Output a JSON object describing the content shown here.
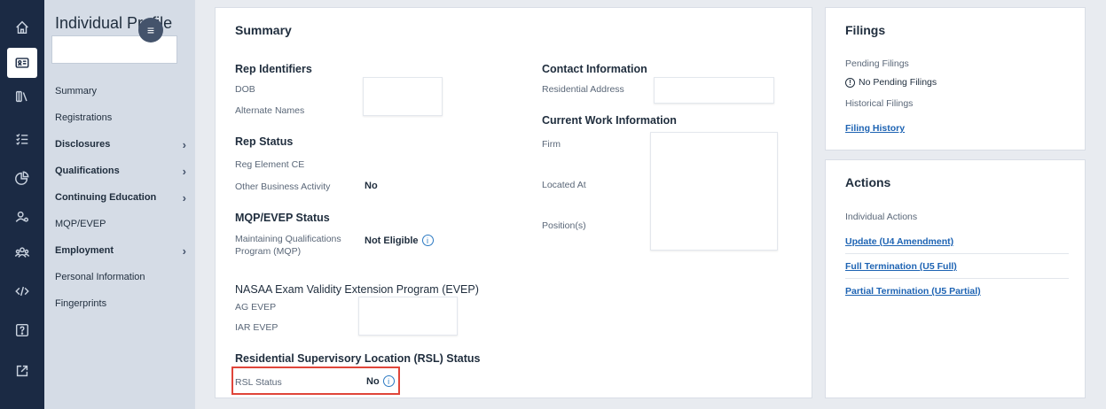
{
  "rail": {
    "icons": [
      "home-icon",
      "profile-card-icon",
      "library-icon",
      "checklist-icon",
      "pie-chart-icon",
      "user-settings-icon",
      "group-icon",
      "code-icon",
      "help-icon",
      "external-link-icon"
    ]
  },
  "nav": {
    "title": "Individual Profile",
    "items": [
      {
        "label": "Summary",
        "bold": false,
        "chevron": false
      },
      {
        "label": "Registrations",
        "bold": false,
        "chevron": false
      },
      {
        "label": "Disclosures",
        "bold": true,
        "chevron": true
      },
      {
        "label": "Qualifications",
        "bold": true,
        "chevron": true
      },
      {
        "label": "Continuing Education",
        "bold": true,
        "chevron": true
      },
      {
        "label": "MQP/EVEP",
        "bold": false,
        "chevron": false
      },
      {
        "label": "Employment",
        "bold": true,
        "chevron": true
      },
      {
        "label": "Personal Information",
        "bold": false,
        "chevron": false
      },
      {
        "label": "Fingerprints",
        "bold": false,
        "chevron": false
      }
    ]
  },
  "summary": {
    "title": "Summary",
    "rep_identifiers": {
      "heading": "Rep Identifiers",
      "dob": "DOB",
      "alternate_names": "Alternate Names"
    },
    "rep_status": {
      "heading": "Rep Status",
      "reg_element_ce": "Reg Element CE",
      "other_business_activity": "Other Business Activity",
      "other_business_value": "No"
    },
    "mqp_evep": {
      "heading": "MQP/EVEP Status",
      "mqp_label": "Maintaining Qualifications Program (MQP)",
      "mqp_value": "Not Eligible"
    },
    "nasaa": {
      "heading": "NASAA Exam Validity Extension Program (EVEP)",
      "ag_evep": "AG EVEP",
      "iar_evep": "IAR EVEP"
    },
    "rsl": {
      "heading": "Residential Supervisory Location (RSL) Status",
      "label": "RSL Status",
      "value": "No"
    },
    "contact": {
      "heading": "Contact Information",
      "residential_address": "Residential Address"
    },
    "work": {
      "heading": "Current Work Information",
      "firm": "Firm",
      "located_at": "Located At",
      "positions": "Position(s)"
    },
    "info_glyph": "i"
  },
  "filings": {
    "title": "Filings",
    "pending_label": "Pending Filings",
    "no_pending": "No Pending Filings",
    "historical_label": "Historical Filings",
    "history_link": "Filing History"
  },
  "actions": {
    "title": "Actions",
    "individual_label": "Individual Actions",
    "links": [
      "Update (U4 Amendment)",
      "Full Termination (U5 Full)",
      "Partial Termination (U5 Partial)"
    ]
  },
  "colors": {
    "rail": "#1b2a44",
    "nav": "#d5dce6",
    "link": "#1d63b3",
    "highlight": "#e0453a"
  }
}
